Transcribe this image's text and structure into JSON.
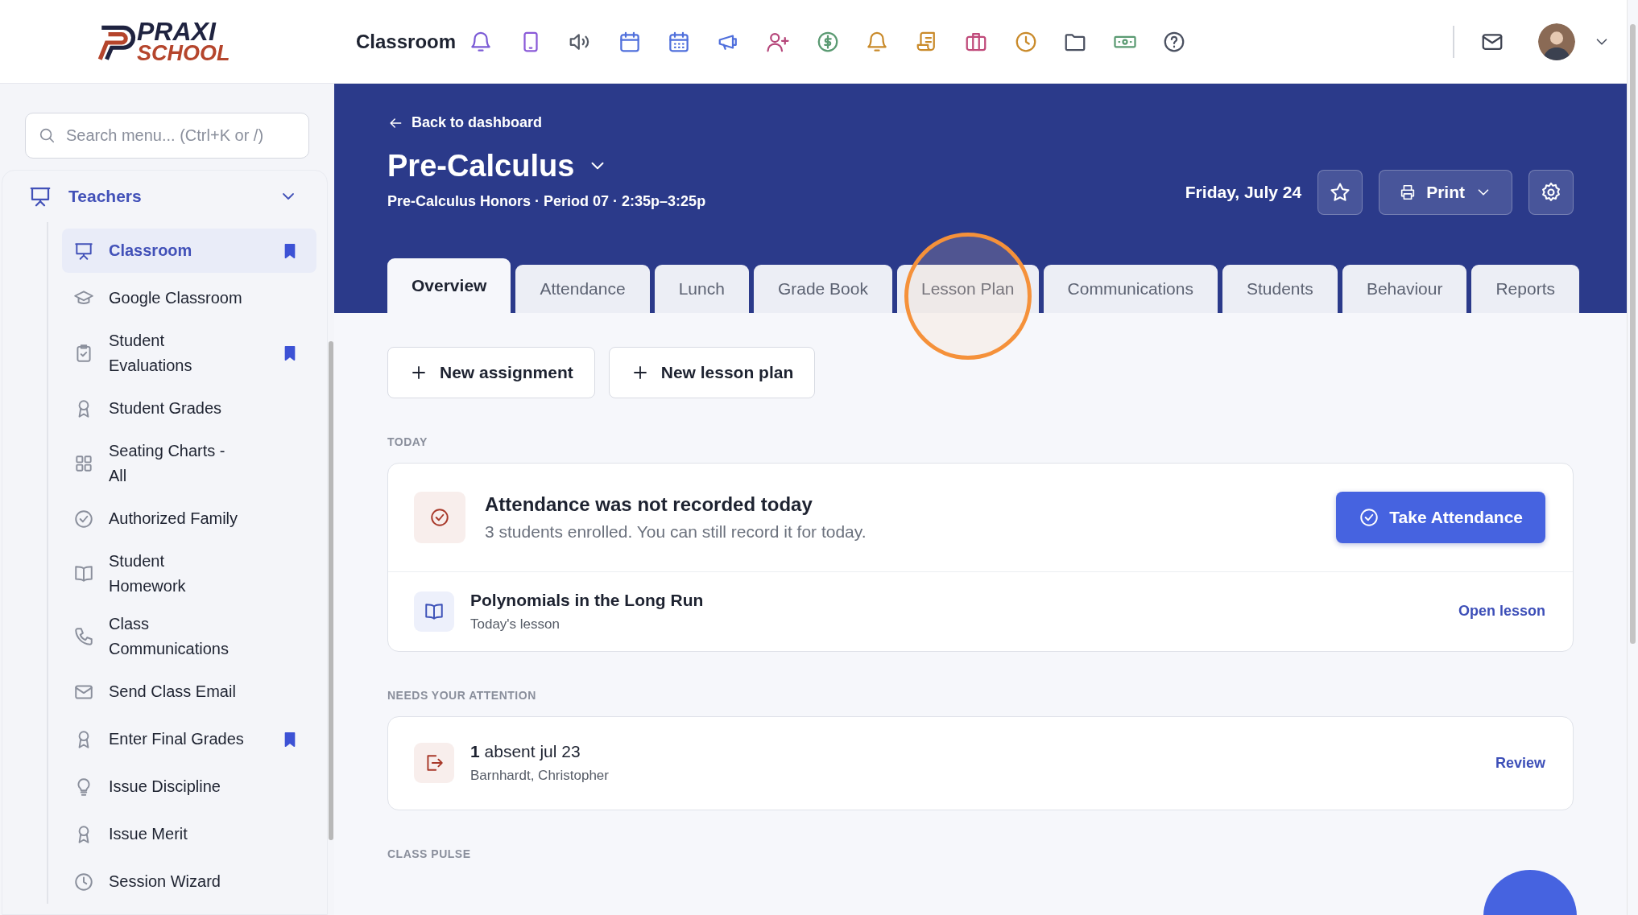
{
  "logo": {
    "top": "PRAXI",
    "bottom": "SCHOOL"
  },
  "topbar": {
    "title": "Classroom",
    "icons": [
      {
        "kind": "bell",
        "color": "#7b5bd6"
      },
      {
        "kind": "tablet",
        "color": "#8a5ad8"
      },
      {
        "kind": "speaker",
        "color": "#555b66"
      },
      {
        "kind": "calendar",
        "color": "#4f6fdc"
      },
      {
        "kind": "calendar-grid",
        "color": "#4f6fdc"
      },
      {
        "kind": "megaphone",
        "color": "#4f6fdc"
      },
      {
        "kind": "user-plus",
        "color": "#b5467a"
      },
      {
        "kind": "dollar",
        "color": "#5a9a72"
      },
      {
        "kind": "bell",
        "color": "#c98a2a"
      },
      {
        "kind": "scroll",
        "color": "#c98a2a"
      },
      {
        "kind": "briefcase",
        "color": "#c04a7a"
      },
      {
        "kind": "clock",
        "color": "#c98a2a"
      },
      {
        "kind": "folder",
        "color": "#4a5060"
      },
      {
        "kind": "cash",
        "color": "#5a9a72"
      },
      {
        "kind": "help",
        "color": "#4a5060"
      }
    ]
  },
  "sidebar": {
    "search": {
      "placeholder": "Search menu... (Ctrl+K or /)"
    },
    "group": {
      "label": "Teachers",
      "expanded": true
    },
    "items": [
      {
        "label": "Classroom",
        "kind": "presentation",
        "selected": true,
        "bookmarked": true
      },
      {
        "label": "Google Classroom",
        "kind": "cap",
        "selected": false,
        "bookmarked": false
      },
      {
        "label": "Student Evaluations",
        "kind": "clipboard",
        "selected": false,
        "bookmarked": true
      },
      {
        "label": "Student Grades",
        "kind": "award",
        "selected": false,
        "bookmarked": false
      },
      {
        "label": "Seating Charts - All",
        "kind": "grid",
        "selected": false,
        "bookmarked": false
      },
      {
        "label": "Authorized Family",
        "kind": "check-circle",
        "selected": false,
        "bookmarked": false
      },
      {
        "label": "Student Homework",
        "kind": "book",
        "selected": false,
        "bookmarked": false
      },
      {
        "label": "Class Communications",
        "kind": "phone",
        "selected": false,
        "bookmarked": false
      },
      {
        "label": "Send Class Email",
        "kind": "mail",
        "selected": false,
        "bookmarked": false
      },
      {
        "label": "Enter Final Grades",
        "kind": "award",
        "selected": false,
        "bookmarked": true
      },
      {
        "label": "Issue Discipline",
        "kind": "bulb",
        "selected": false,
        "bookmarked": false
      },
      {
        "label": "Issue Merit",
        "kind": "award",
        "selected": false,
        "bookmarked": false
      },
      {
        "label": "Session Wizard",
        "kind": "clock",
        "selected": false,
        "bookmarked": false
      }
    ]
  },
  "header": {
    "back": "Back to dashboard",
    "title": "Pre-Calculus",
    "subtitle": "Pre-Calculus Honors · Period 07 · 2:35p–3:25p",
    "date": "Friday, July 24",
    "print": "Print"
  },
  "tabs": [
    {
      "label": "Overview",
      "selected": true,
      "highlighted": false
    },
    {
      "label": "Attendance",
      "selected": false,
      "highlighted": false
    },
    {
      "label": "Lunch",
      "selected": false,
      "highlighted": false
    },
    {
      "label": "Grade Book",
      "selected": false,
      "highlighted": false
    },
    {
      "label": "Lesson Plan",
      "selected": false,
      "highlighted": true
    },
    {
      "label": "Communications",
      "selected": false,
      "highlighted": false
    },
    {
      "label": "Students",
      "selected": false,
      "highlighted": false
    },
    {
      "label": "Behaviour",
      "selected": false,
      "highlighted": false
    },
    {
      "label": "Reports",
      "selected": false,
      "highlighted": false
    }
  ],
  "actions": [
    "New assignment",
    "New lesson plan"
  ],
  "sections": [
    {
      "label": "TODAY",
      "rows": [
        {
          "kind": "alert",
          "title": "Attendance was not recorded today",
          "text": "3 students enrolled. You can still record it for today.",
          "action": "Take Attendance"
        },
        {
          "kind": "lesson",
          "title": "Polynomials in the Long Run",
          "text": "Today's lesson",
          "action": "Open lesson"
        }
      ]
    },
    {
      "label": "NEEDS YOUR ATTENTION",
      "rows": [
        {
          "kind": "absence",
          "title": "**1** absent jul 23",
          "text": "Barnhardt, Christopher",
          "action": "Review"
        }
      ]
    },
    {
      "label": "CLASS PULSE"
    }
  ]
}
